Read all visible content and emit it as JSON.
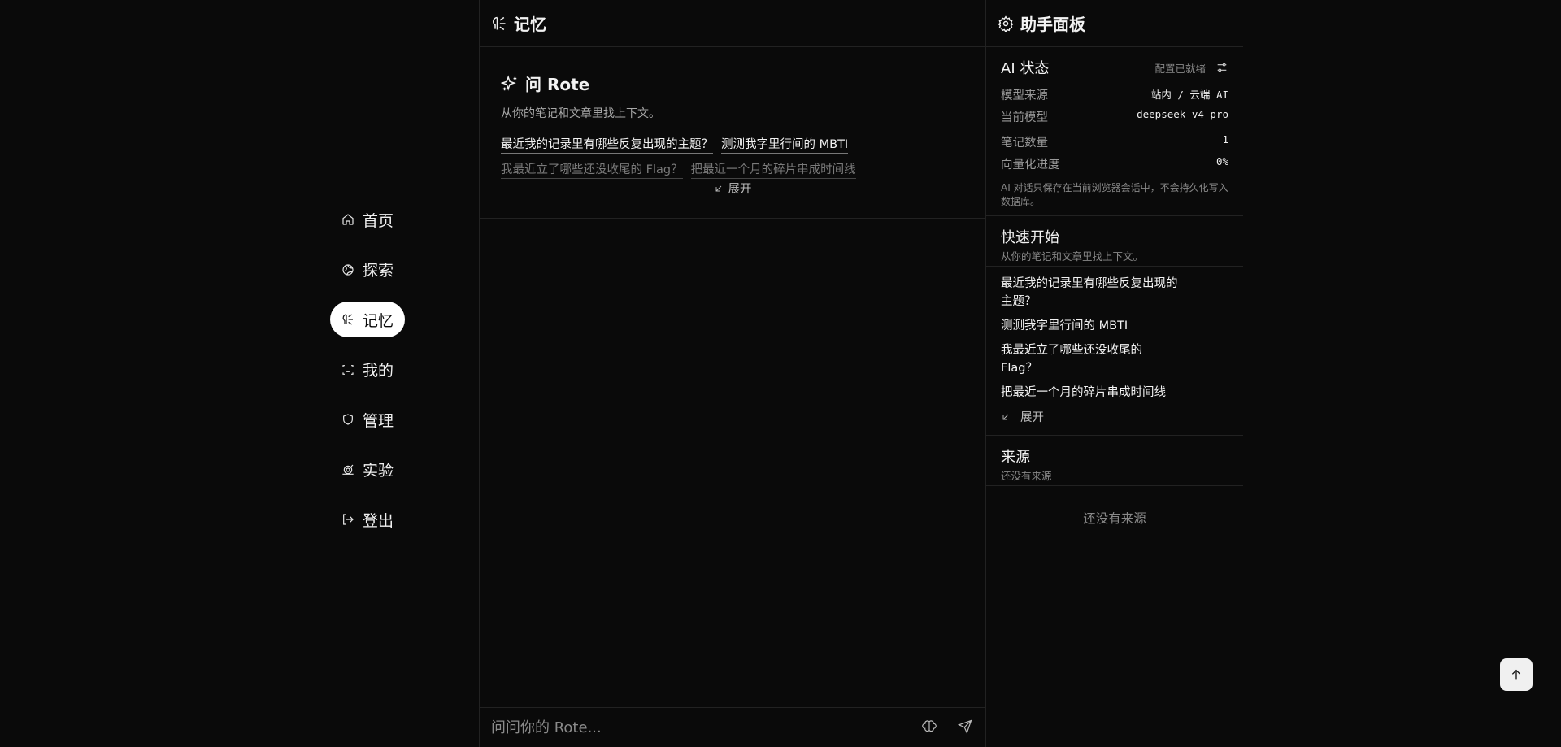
{
  "nav": {
    "items": [
      {
        "label": "首页",
        "icon": "home-icon"
      },
      {
        "label": "探索",
        "icon": "compass-icon"
      },
      {
        "label": "记忆",
        "icon": "memory-icon",
        "active": true
      },
      {
        "label": "我的",
        "icon": "scan-face-icon"
      },
      {
        "label": "管理",
        "icon": "shield-icon"
      },
      {
        "label": "实验",
        "icon": "snail-icon"
      },
      {
        "label": "登出",
        "icon": "logout-icon"
      }
    ]
  },
  "main": {
    "title": "记忆",
    "ask": {
      "title": "问 Rote",
      "subtitle": "从你的笔记和文章里找上下文。",
      "suggestions": [
        "最近我的记录里有哪些反复出现的主题？",
        "测测我字里行间的 MBTI",
        "我最近立了哪些还没收尾的 Flag？",
        "把最近一个月的碎片串成时间线"
      ],
      "expand_label": "展开"
    },
    "input": {
      "placeholder": "问问你的 Rote..."
    }
  },
  "panel": {
    "title": "助手面板",
    "ai_status": {
      "title": "AI 状态",
      "config_status": "配置已就绪",
      "rows": [
        {
          "key": "模型来源",
          "value": "站内 / 云端 AI"
        },
        {
          "key": "当前模型",
          "value": "deepseek-v4-pro"
        },
        {
          "key": "笔记数量",
          "value": "1"
        },
        {
          "key": "向量化进度",
          "value": "0%"
        }
      ],
      "note": "AI 对话只保存在当前浏览器会话中，不会持久化写入数据库。"
    },
    "quick_start": {
      "title": "快速开始",
      "subtitle": "从你的笔记和文章里找上下文。",
      "questions": [
        "最近我的记录里有哪些反复出现的主题？",
        "测测我字里行间的 MBTI",
        "我最近立了哪些还没收尾的 Flag？",
        "把最近一个月的碎片串成时间线"
      ],
      "expand_label": "展开"
    },
    "sources": {
      "title": "来源",
      "subtitle": "还没有来源",
      "empty": "还没有来源"
    }
  }
}
